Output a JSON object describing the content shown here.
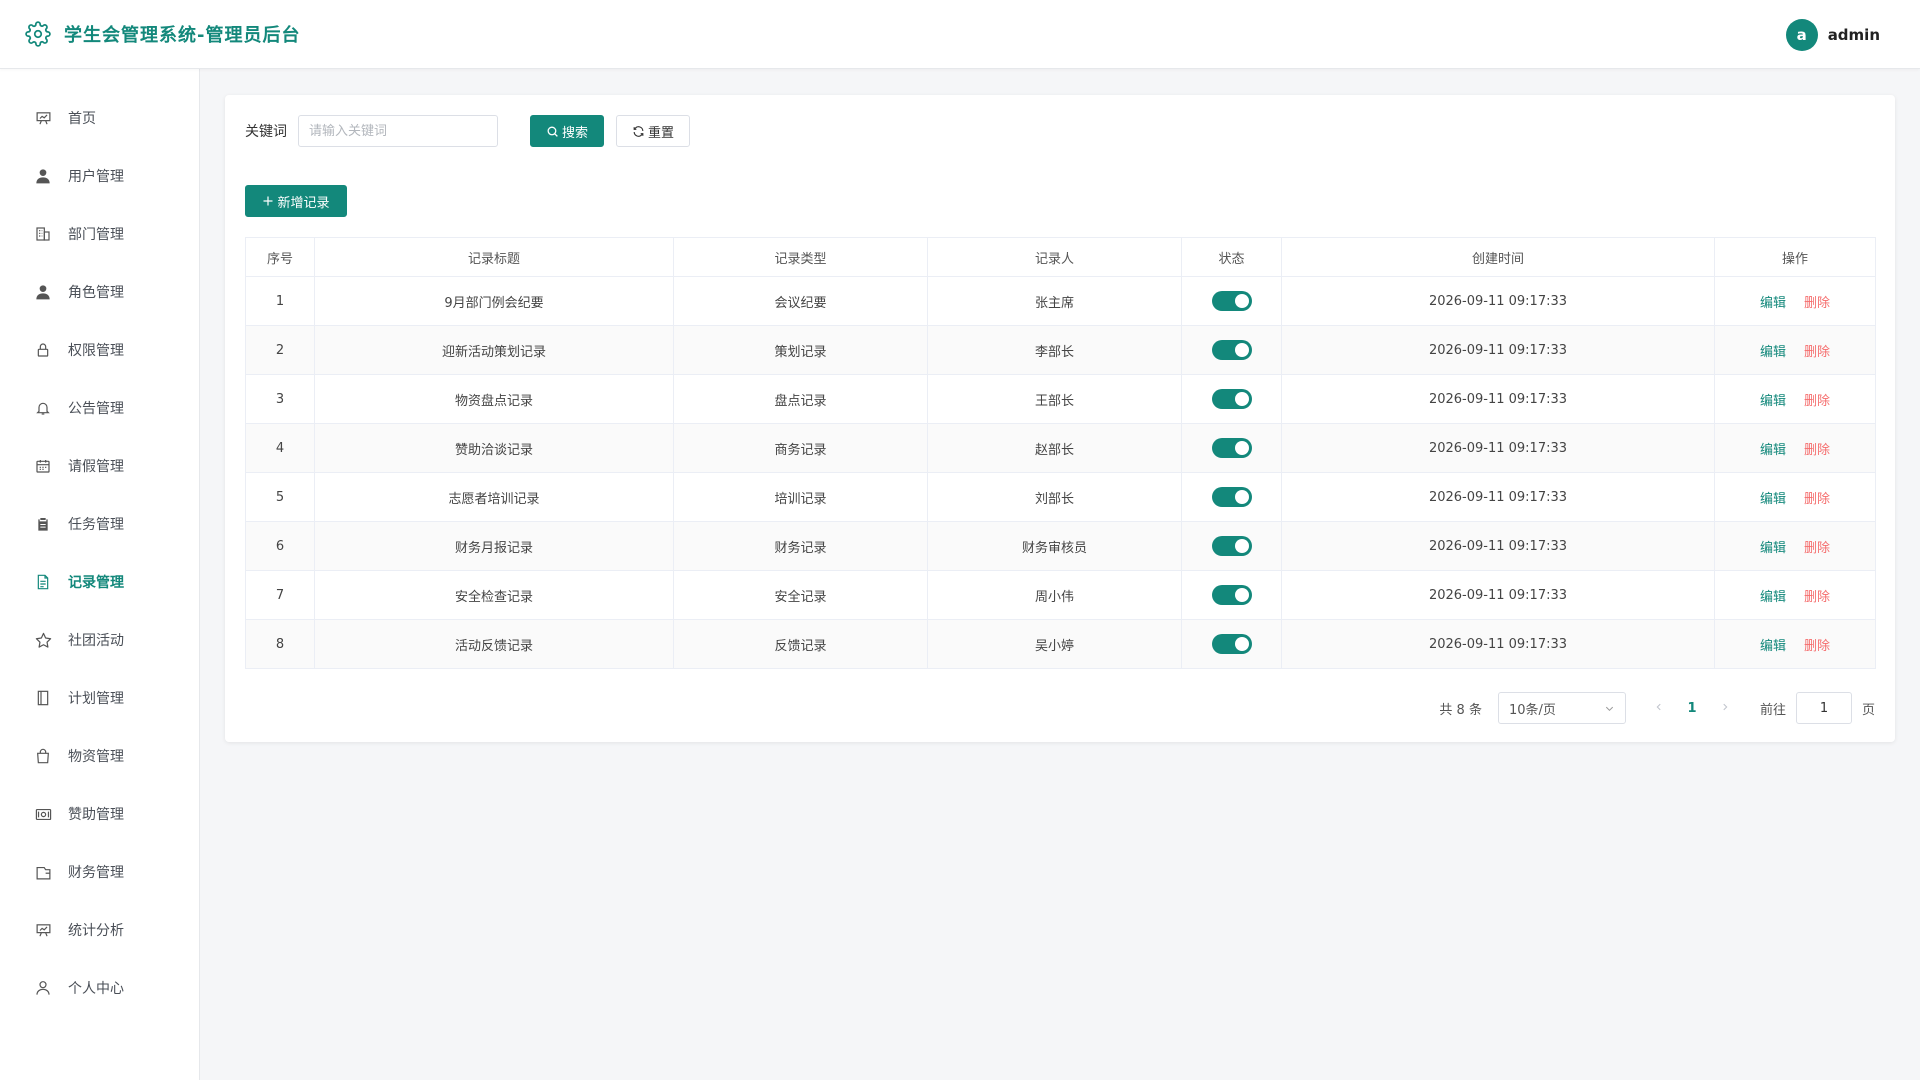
{
  "header": {
    "title": "学生会管理系统-管理员后台",
    "user_initial": "a",
    "username": "admin"
  },
  "colors": {
    "primary": "#13887b",
    "danger": "#f56c6c"
  },
  "sidebar": {
    "items": [
      {
        "label": "首页",
        "icon": "presentation-icon"
      },
      {
        "label": "用户管理",
        "icon": "user-icon"
      },
      {
        "label": "部门管理",
        "icon": "building-icon"
      },
      {
        "label": "角色管理",
        "icon": "user-icon"
      },
      {
        "label": "权限管理",
        "icon": "lock-icon"
      },
      {
        "label": "公告管理",
        "icon": "bell-icon"
      },
      {
        "label": "请假管理",
        "icon": "calendar-icon"
      },
      {
        "label": "任务管理",
        "icon": "clipboard-icon"
      },
      {
        "label": "记录管理",
        "icon": "document-icon",
        "active": true
      },
      {
        "label": "社团活动",
        "icon": "star-icon"
      },
      {
        "label": "计划管理",
        "icon": "notebook-icon"
      },
      {
        "label": "物资管理",
        "icon": "bag-icon"
      },
      {
        "label": "赞助管理",
        "icon": "money-icon"
      },
      {
        "label": "财务管理",
        "icon": "wallet-icon"
      },
      {
        "label": "统计分析",
        "icon": "chart-board-icon"
      },
      {
        "label": "个人中心",
        "icon": "person-outline-icon"
      }
    ]
  },
  "filter": {
    "keyword_label": "关键词",
    "keyword_placeholder": "请输入关键词",
    "keyword_value": "",
    "search_label": "搜索",
    "reset_label": "重置"
  },
  "toolbar": {
    "add_label": "新增记录"
  },
  "table": {
    "columns": [
      "序号",
      "记录标题",
      "记录类型",
      "记录人",
      "状态",
      "创建时间",
      "操作"
    ],
    "edit_label": "编辑",
    "delete_label": "删除",
    "rows": [
      {
        "index": "1",
        "title": "9月部门例会纪要",
        "type": "会议纪要",
        "recorder": "张主席",
        "status": true,
        "created": "2026-09-11 09:17:33"
      },
      {
        "index": "2",
        "title": "迎新活动策划记录",
        "type": "策划记录",
        "recorder": "李部长",
        "status": true,
        "created": "2026-09-11 09:17:33"
      },
      {
        "index": "3",
        "title": "物资盘点记录",
        "type": "盘点记录",
        "recorder": "王部长",
        "status": true,
        "created": "2026-09-11 09:17:33"
      },
      {
        "index": "4",
        "title": "赞助洽谈记录",
        "type": "商务记录",
        "recorder": "赵部长",
        "status": true,
        "created": "2026-09-11 09:17:33"
      },
      {
        "index": "5",
        "title": "志愿者培训记录",
        "type": "培训记录",
        "recorder": "刘部长",
        "status": true,
        "created": "2026-09-11 09:17:33"
      },
      {
        "index": "6",
        "title": "财务月报记录",
        "type": "财务记录",
        "recorder": "财务审核员",
        "status": true,
        "created": "2026-09-11 09:17:33"
      },
      {
        "index": "7",
        "title": "安全检查记录",
        "type": "安全记录",
        "recorder": "周小伟",
        "status": true,
        "created": "2026-09-11 09:17:33"
      },
      {
        "index": "8",
        "title": "活动反馈记录",
        "type": "反馈记录",
        "recorder": "吴小婷",
        "status": true,
        "created": "2026-09-11 09:17:33"
      }
    ]
  },
  "pagination": {
    "total_text": "共 8 条",
    "page_size": "10条/页",
    "current_page": "1",
    "goto_label": "前往",
    "goto_value": "1",
    "page_suffix": "页"
  }
}
